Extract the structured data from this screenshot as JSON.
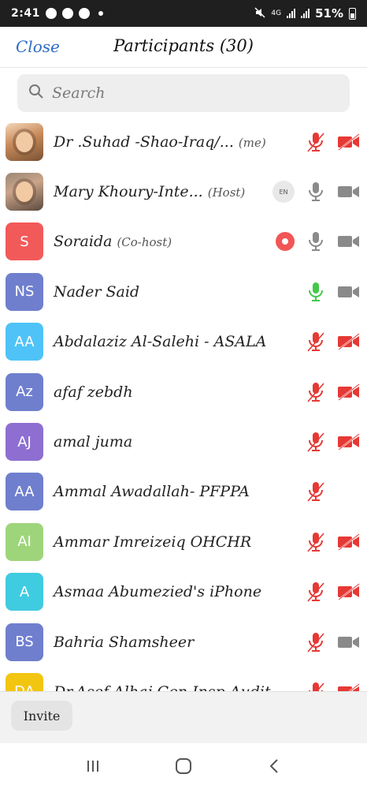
{
  "status_bar": {
    "time": "2:41",
    "network": "4G",
    "battery": "51%"
  },
  "header": {
    "close_label": "Close",
    "title": "Participants (30)"
  },
  "search": {
    "placeholder": "Search"
  },
  "participants": [
    {
      "name": "Dr .Suhad -Shao-Iraq/...",
      "role": "(me)",
      "avatar_type": "photo1",
      "mic": "muted",
      "video": "off"
    },
    {
      "name": "Mary Khoury-Inte...",
      "role": "(Host)",
      "avatar_type": "photo2",
      "extra": "EN",
      "mic": "on",
      "video": "on"
    },
    {
      "name": "Soraida",
      "role": "(Co-host)",
      "initials": "S",
      "color": "#f25a5a",
      "extra": "record",
      "mic": "on",
      "video": "on"
    },
    {
      "name": "Nader Said",
      "role": "",
      "initials": "NS",
      "color": "#6f7fce",
      "mic": "active",
      "video": "on"
    },
    {
      "name": "Abdalaziz Al-Salehi - ASALA",
      "role": "",
      "initials": "AA",
      "color": "#4fc3f7",
      "mic": "muted",
      "video": "off"
    },
    {
      "name": "afaf zebdh",
      "role": "",
      "initials": "Az",
      "color": "#6f7fce",
      "mic": "muted",
      "video": "off"
    },
    {
      "name": "amal juma",
      "role": "",
      "initials": "AJ",
      "color": "#8e6fd1",
      "mic": "muted",
      "video": "off"
    },
    {
      "name": "Ammal Awadallah- PFPPA",
      "role": "",
      "initials": "AA",
      "color": "#6f7fce",
      "mic": "muted",
      "video": "none"
    },
    {
      "name": "Ammar Imreizeiq OHCHR",
      "role": "",
      "initials": "AI",
      "color": "#9ed57a",
      "mic": "muted",
      "video": "off"
    },
    {
      "name": "Asmaa Abumezied's iPhone",
      "role": "",
      "initials": "A",
      "color": "#3fcbe0",
      "mic": "muted",
      "video": "off"
    },
    {
      "name": "Bahria Shamsheer",
      "role": "",
      "initials": "BS",
      "color": "#6f7fce",
      "mic": "muted",
      "video": "on"
    },
    {
      "name": "Dr.Asef Alhaj Gen.Insp.Audit",
      "role": "",
      "initials": "DA",
      "color": "#f2c511",
      "mic": "muted",
      "video": "off"
    }
  ],
  "invite": {
    "label": "Invite"
  },
  "colors": {
    "accent": "#2d6bc4",
    "muted_red": "#e53935",
    "active_green": "#43c94a",
    "icon_gray": "#8a8a8a"
  }
}
